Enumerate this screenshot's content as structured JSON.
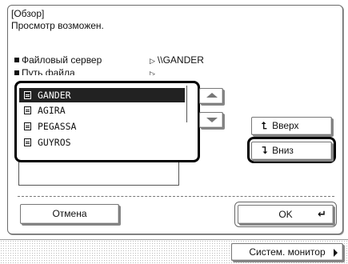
{
  "header": {
    "title": "[Обзор]",
    "message": "Просмотр возможен."
  },
  "info": {
    "server_label": "Файловый сервер",
    "server_value": "\\\\GANDER",
    "path_label": "Путь файла",
    "path_value": ""
  },
  "file_list": {
    "items": [
      {
        "label": "GANDER",
        "selected": true
      },
      {
        "label": "AGIRA",
        "selected": false
      },
      {
        "label": "PEGASSA",
        "selected": false
      },
      {
        "label": "GUYROS",
        "selected": false
      }
    ]
  },
  "buttons": {
    "up_label": "Вверх",
    "down_label": "Вниз",
    "cancel_label": "Отмена",
    "ok_label": "OK",
    "system_monitor_label": "Систем. монитор"
  },
  "icons": {
    "folder": "folder-icon",
    "scroll_up": "triangle-up-icon",
    "scroll_down": "triangle-down-icon",
    "up_arrow": "arrow-up-icon",
    "down_arrow": "arrow-down-icon",
    "enter": "enter-return-icon",
    "system_monitor": "triangle-right-icon"
  }
}
